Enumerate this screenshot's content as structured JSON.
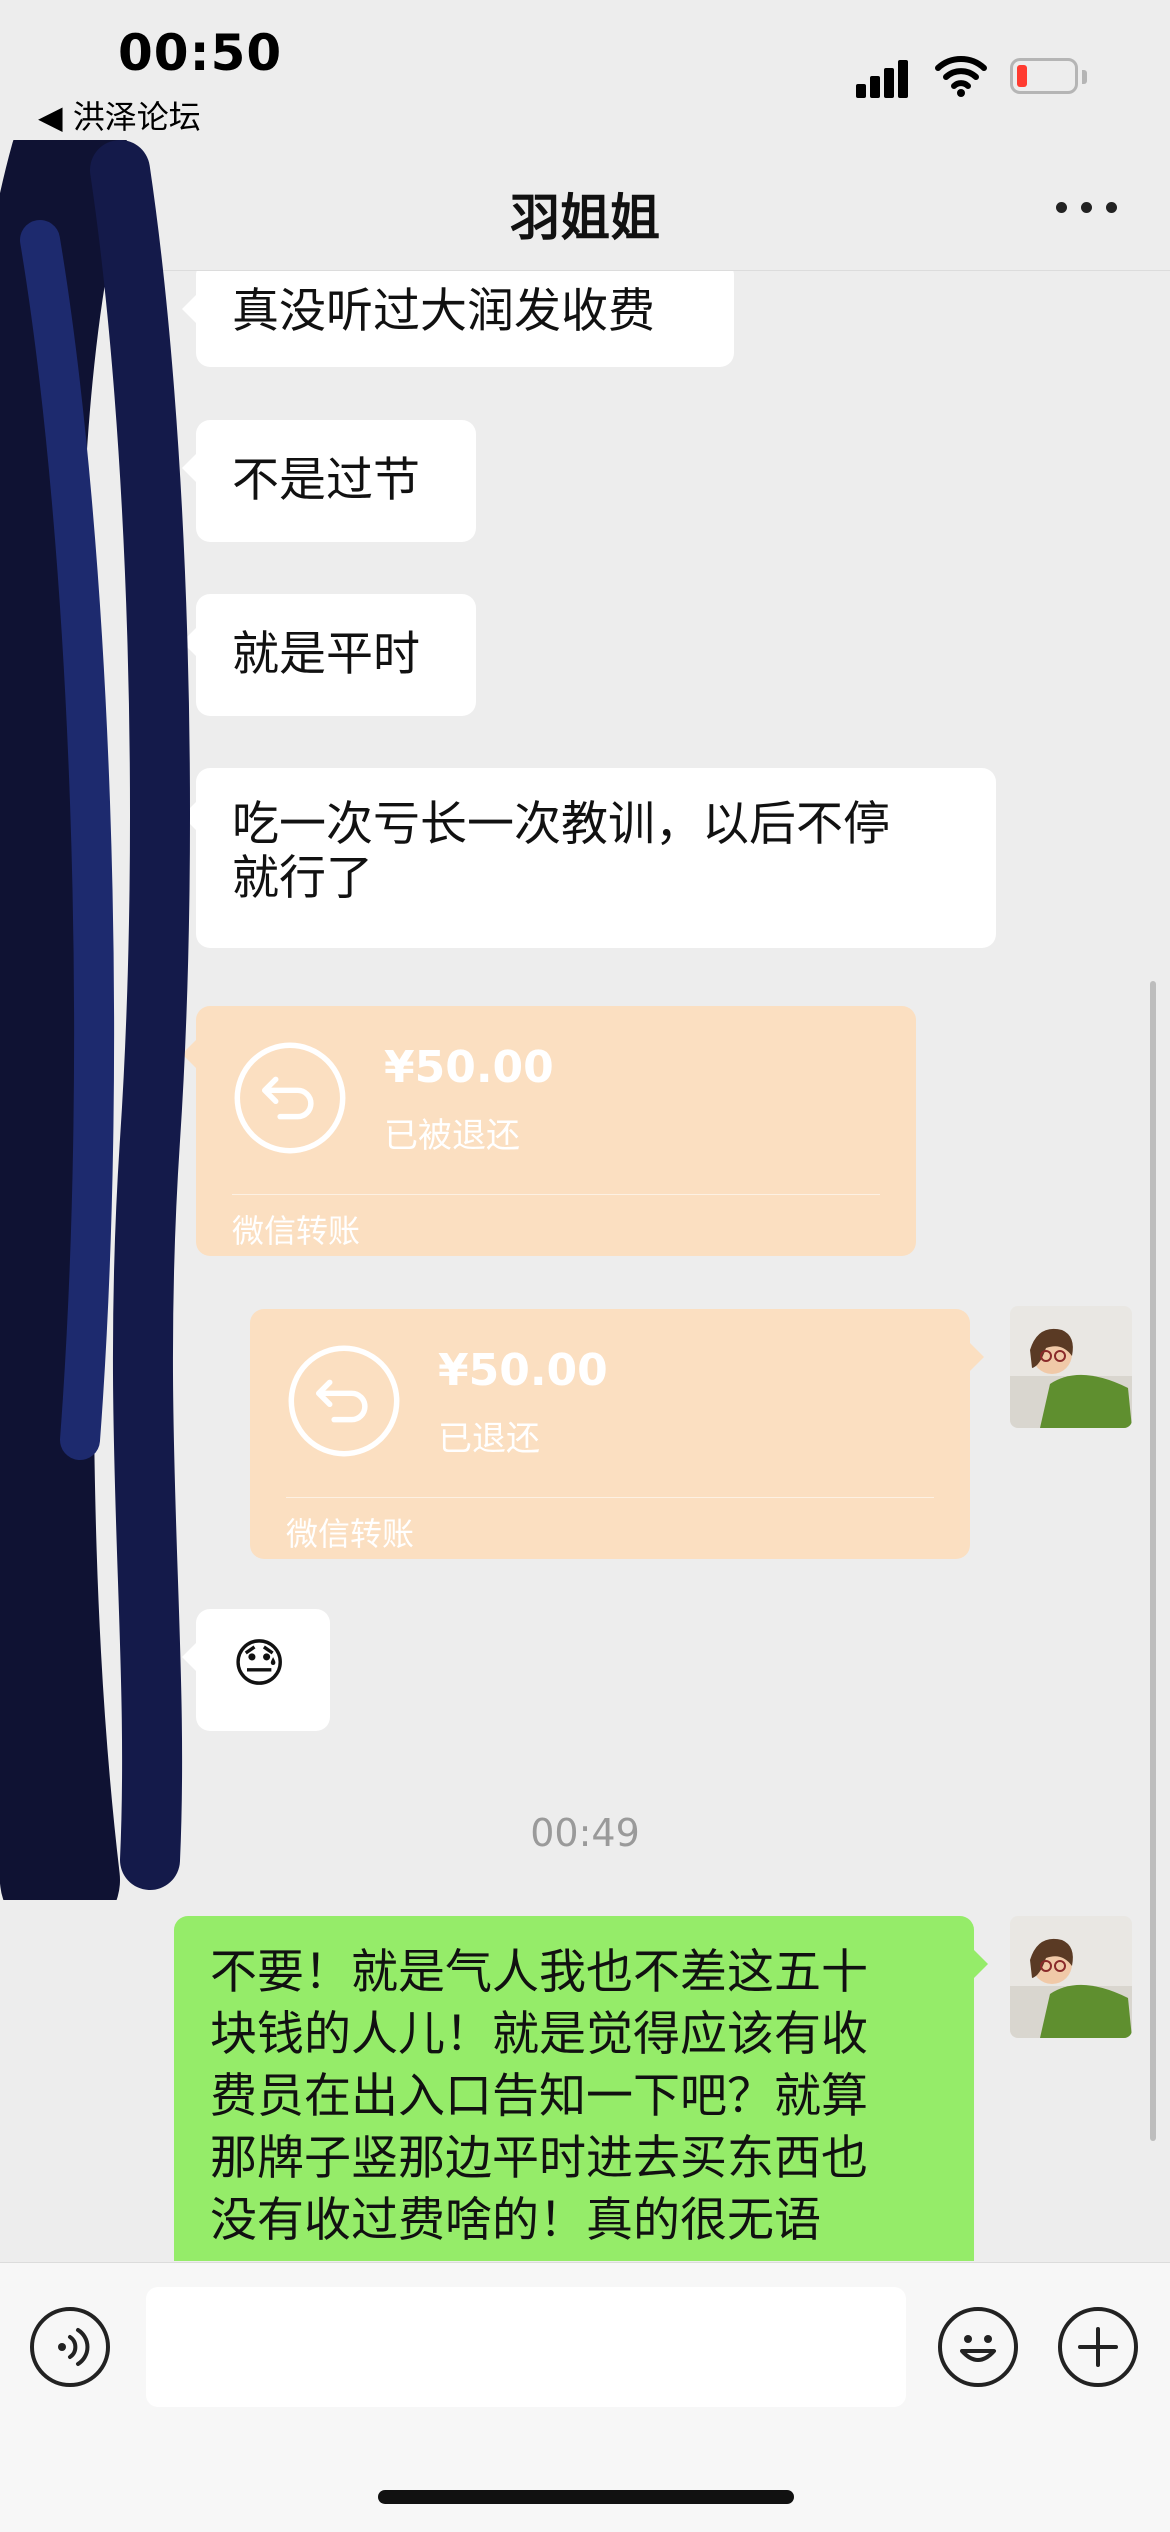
{
  "status_bar": {
    "time": "00:50",
    "back_app": "◀ 洪泽论坛"
  },
  "nav": {
    "title": "羽姐姐"
  },
  "messages": [
    {
      "side": "left",
      "type": "text",
      "text": "真没听过大润发收费"
    },
    {
      "side": "left",
      "type": "text",
      "text": "不是过节"
    },
    {
      "side": "left",
      "type": "text",
      "text": "就是平时"
    },
    {
      "side": "left",
      "type": "text",
      "text_line1": "吃一次亏长一次教训，以后不停",
      "text_line2": "就行了"
    },
    {
      "side": "left",
      "type": "transfer",
      "amount": "¥50.00",
      "status": "已被退还",
      "label": "微信转账"
    },
    {
      "side": "right",
      "type": "transfer",
      "amount": "¥50.00",
      "status": "已退还",
      "label": "微信转账"
    },
    {
      "side": "left",
      "type": "emoji",
      "text": "😓"
    }
  ],
  "timestamp": "00:49",
  "my_message": {
    "lines": [
      "不要！就是气人我也不差这五十",
      "块钱的人儿！就是觉得应该有收",
      "费员在出入口告知一下吧？就算",
      "那牌子竖那边平时进去买东西也",
      "没有收过费啥的！真的很无语"
    ]
  },
  "input_bar": {
    "placeholder": ""
  },
  "colors": {
    "background": "#ededed",
    "my_bubble": "#95ec69",
    "their_bubble": "#ffffff",
    "transfer_returned": "#fbdfc1",
    "battery_low": "#ff3b30"
  },
  "icons": [
    "back-chevron-icon",
    "more-icon",
    "voice-icon",
    "emoji-icon",
    "plus-icon",
    "transfer-return-icon",
    "signal-icon",
    "wifi-icon",
    "battery-icon"
  ]
}
